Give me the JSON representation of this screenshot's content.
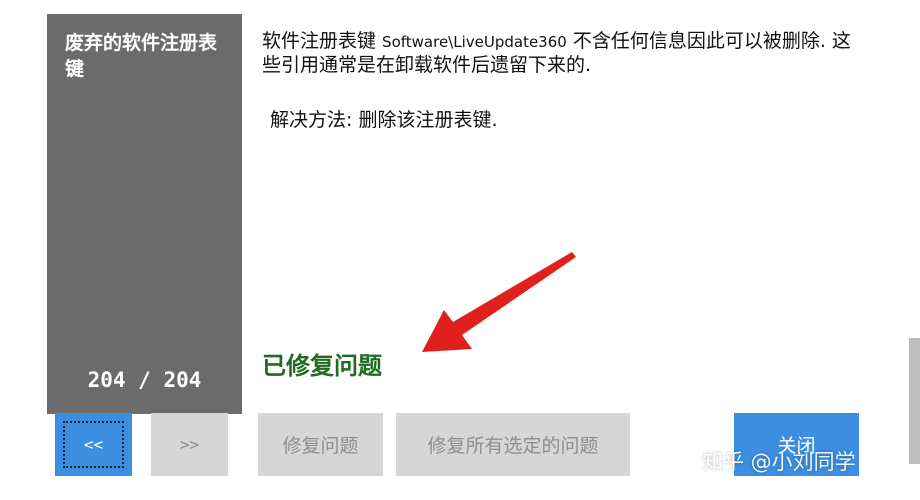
{
  "sidebar": {
    "title": "废弃的软件注册表键",
    "counter": "204 / 204",
    "prev_label": "<<",
    "next_label": ">>"
  },
  "issue": {
    "description_prefix": "软件注册表键 ",
    "registry_path": "Software\\LiveUpdate360",
    "description_suffix": " 不含任何信息因此可以被删除. 这些引用通常是在卸载软件后遗留下来的.",
    "solution": "解决方法: 删除该注册表键.",
    "status": "已修复问题"
  },
  "buttons": {
    "fix": "修复问题",
    "fix_all": "修复所有选定的问题",
    "close": "关闭"
  },
  "watermark": "知乎 @小刘同学",
  "colors": {
    "sidebar_bg": "#6b6b6b",
    "accent_blue": "#3c8fe0",
    "disabled_bg": "#d6d6d6",
    "status_green": "#1f6b1f",
    "arrow_red": "#e0201c"
  }
}
